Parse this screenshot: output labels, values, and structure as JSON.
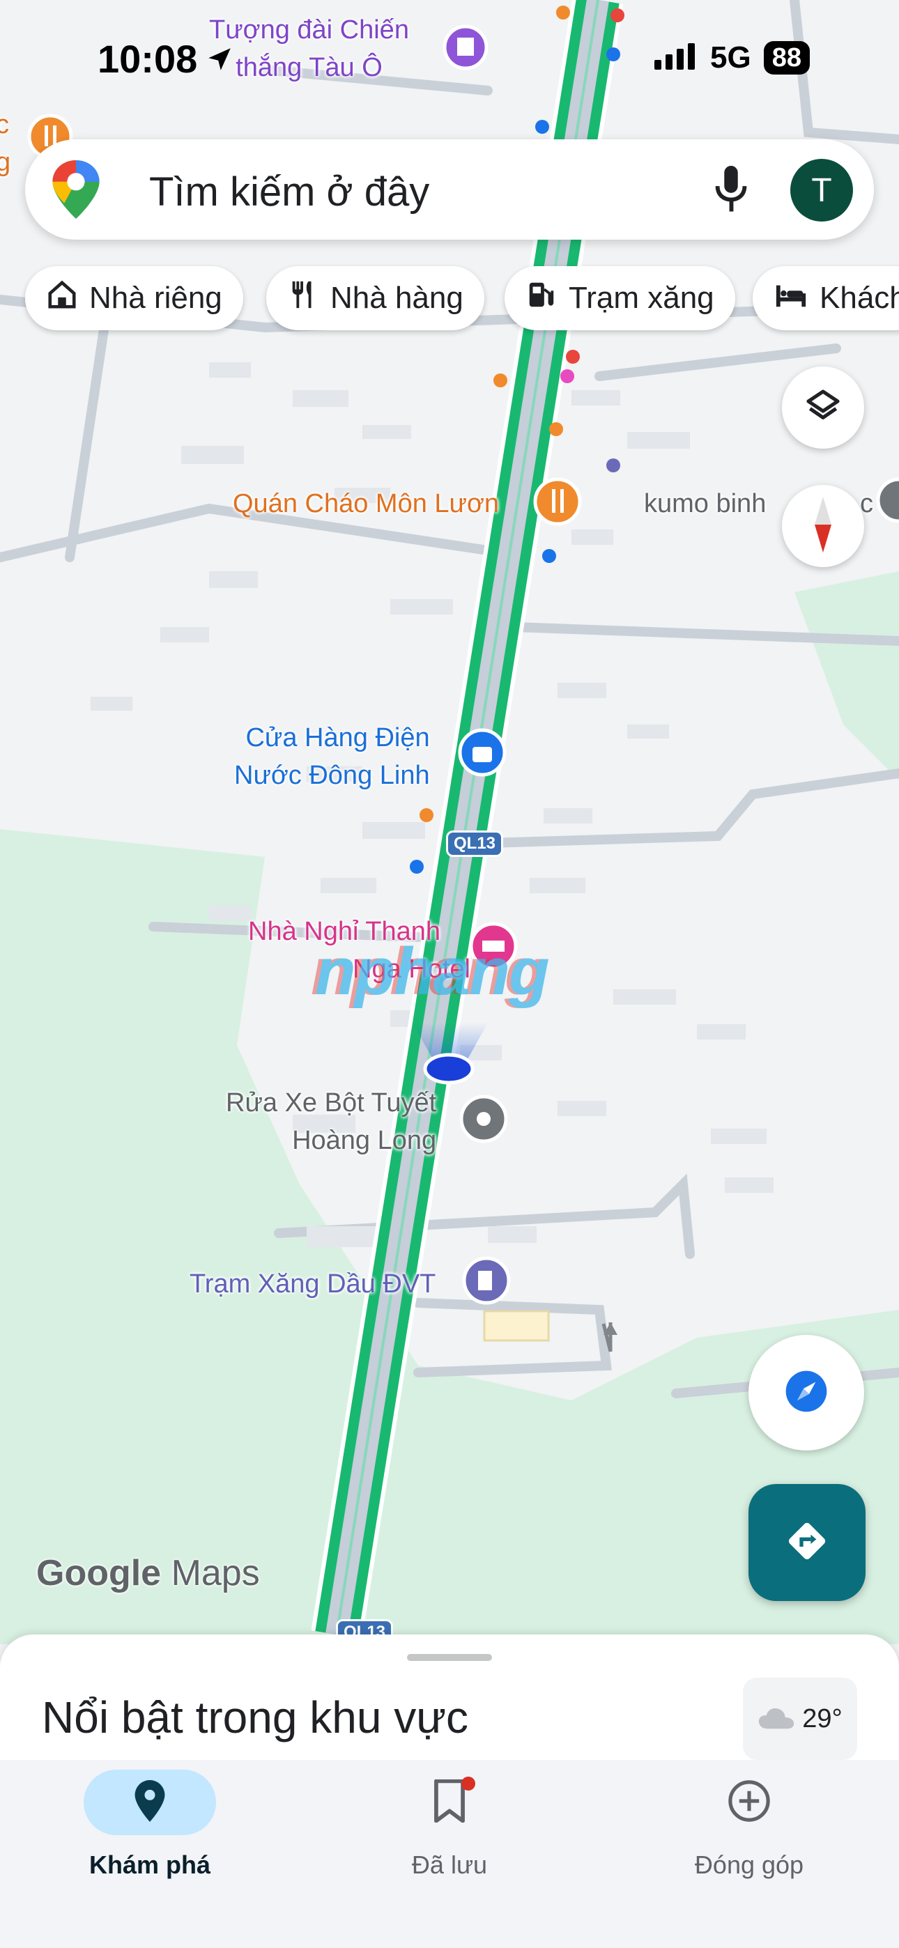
{
  "status_bar": {
    "time": "10:08",
    "network": "5G",
    "battery": "88"
  },
  "search": {
    "placeholder": "Tìm kiếm ở đây",
    "avatar_letter": "T"
  },
  "chips": [
    {
      "label": "Nhà riêng",
      "icon": "home-icon"
    },
    {
      "label": "Nhà hàng",
      "icon": "restaurant-icon"
    },
    {
      "label": "Trạm xăng",
      "icon": "gas-station-icon"
    },
    {
      "label": "Khách",
      "icon": "hotel-icon"
    }
  ],
  "map": {
    "places": {
      "monument": {
        "line1": "Tượng đài Chiến",
        "line2": "thắng Tàu Ô"
      },
      "restaurant": "Quán Cháo Môn Lươn",
      "kumo": "kumo binh",
      "kumo_tail": "c",
      "store": {
        "line1": "Cửa Hàng Điện",
        "line2": "Nước Đông Linh"
      },
      "hotel": {
        "line1": "Nhà Nghỉ Thanh",
        "line2": "Nga Hotel"
      },
      "carwash": {
        "line1": "Rửa Xe Bột Tuyết",
        "line2": "Hoàng Long"
      },
      "gas": "Trạm Xăng Dầu ĐVT",
      "edge_left": {
        "line1": "c",
        "line2": "g"
      }
    },
    "road_badge": "QL13",
    "road_badge_bottom": "QL13",
    "watermark": "nphang",
    "logo": {
      "google": "Google",
      "maps": "Maps"
    },
    "colors": {
      "route": "#1fc77a",
      "road": "#c8d1dc",
      "green_area": "#d8f0e1",
      "accent_teal": "#0b6e7c"
    }
  },
  "sheet": {
    "title": "Nổi bật trong khu vực",
    "weather": "29°"
  },
  "bottom_nav": [
    {
      "label": "Khám phá",
      "icon": "explore-pin-icon",
      "active": true
    },
    {
      "label": "Đã lưu",
      "icon": "bookmark-icon",
      "active": false
    },
    {
      "label": "Đóng góp",
      "icon": "add-circle-icon",
      "active": false
    }
  ]
}
